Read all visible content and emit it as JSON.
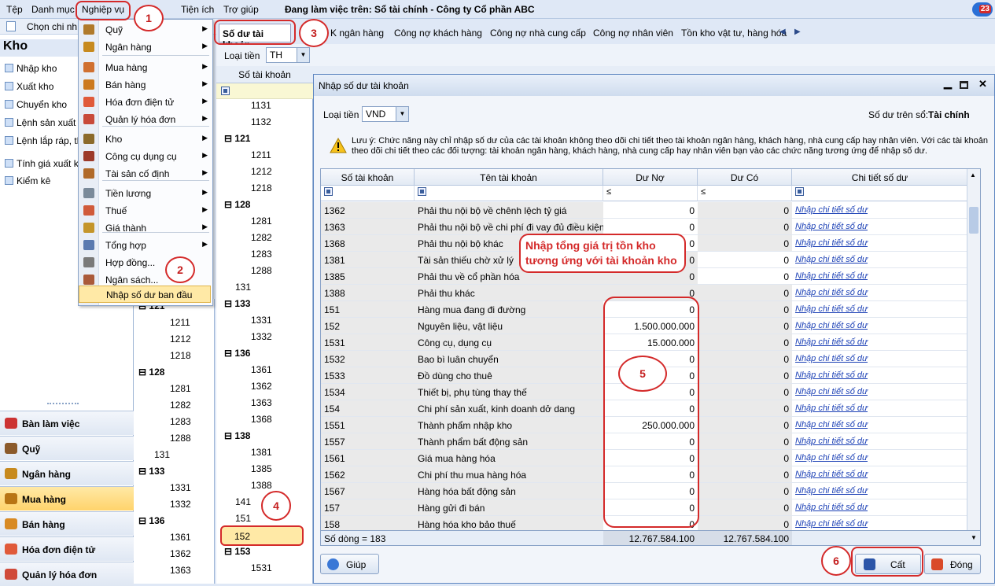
{
  "menubar": {
    "items": [
      "Tệp",
      "Danh mục",
      "Nghiệp vụ",
      "Tiện ích",
      "Trợ giúp"
    ],
    "app_title": "Đang làm việc trên: Sổ tài chính - Công ty Cổ phần ABC",
    "badge": "23"
  },
  "toolbar": {
    "chon_chi_nhanh": "Chọn chi nh"
  },
  "sidebar": {
    "title": "Kho",
    "items": [
      "Nhập kho",
      "Xuất kho",
      "Chuyển kho",
      "Lệnh sản xuất",
      "Lệnh lắp ráp, th",
      "Tính giá xuất kh",
      "Kiểm kê"
    ],
    "nav": [
      "Bàn làm việc",
      "Quỹ",
      "Ngân hàng",
      "Mua hàng",
      "Bán hàng",
      "Hóa đơn điện tử",
      "Quản lý hóa đơn"
    ]
  },
  "menu": {
    "items": [
      "Quỹ",
      "Ngân hàng",
      "Mua hàng",
      "Bán hàng",
      "Hóa đơn điện tử",
      "Quản lý hóa đơn",
      "Kho",
      "Công cụ dụng cụ",
      "Tài sản cố định",
      "Tiền lương",
      "Thuế",
      "Giá thành",
      "Tổng hợp",
      "Hợp đồng...",
      "Ngân sách...",
      "Nhập số dư ban đầu"
    ]
  },
  "tabs": {
    "active": "Số dư tài khoản",
    "others": [
      "K ngân hàng",
      "Công nợ khách hàng",
      "Công nợ nhà cung cấp",
      "Công nợ nhân viên",
      "Tồn kho vật tư, hàng hóa"
    ]
  },
  "filter": {
    "label": "Loại tiền",
    "value": "TH"
  },
  "tree_header": "Số tài khoản",
  "tree2": [
    {
      "t": "1131",
      "g": false
    },
    {
      "t": "1132",
      "g": false
    },
    {
      "t": "121",
      "g": true
    },
    {
      "t": "1211",
      "g": false
    },
    {
      "t": "1212",
      "g": false
    },
    {
      "t": "1218",
      "g": false
    },
    {
      "t": "128",
      "g": true
    },
    {
      "t": "1281",
      "g": false
    },
    {
      "t": "1282",
      "g": false
    },
    {
      "t": "1283",
      "g": false
    },
    {
      "t": "1288",
      "g": false
    },
    {
      "t": "131",
      "g": false
    },
    {
      "t": "133",
      "g": true
    },
    {
      "t": "1331",
      "g": false
    },
    {
      "t": "1332",
      "g": false
    },
    {
      "t": "136",
      "g": true
    },
    {
      "t": "1361",
      "g": false
    },
    {
      "t": "1362",
      "g": false
    },
    {
      "t": "1363",
      "g": false
    },
    {
      "t": "1368",
      "g": false
    },
    {
      "t": "138",
      "g": true
    },
    {
      "t": "1381",
      "g": false
    },
    {
      "t": "1385",
      "g": false
    },
    {
      "t": "1388",
      "g": false
    },
    {
      "t": "141",
      "g": false
    },
    {
      "t": "151",
      "g": false
    },
    {
      "t": "152",
      "g": false
    },
    {
      "t": "153",
      "g": true
    },
    {
      "t": "1531",
      "g": false
    }
  ],
  "tree1": [
    {
      "t": "121",
      "g": true
    },
    {
      "t": "1211",
      "g": false
    },
    {
      "t": "1212",
      "g": false
    },
    {
      "t": "1218",
      "g": false
    },
    {
      "t": "128",
      "g": true
    },
    {
      "t": "1281",
      "g": false
    },
    {
      "t": "1282",
      "g": false
    },
    {
      "t": "1283",
      "g": false
    },
    {
      "t": "1288",
      "g": false
    },
    {
      "t": "131",
      "g": false
    },
    {
      "t": "133",
      "g": true
    },
    {
      "t": "1331",
      "g": false
    },
    {
      "t": "1332",
      "g": false
    },
    {
      "t": "136",
      "g": true
    },
    {
      "t": "1361",
      "g": false
    },
    {
      "t": "1362",
      "g": false
    },
    {
      "t": "1363",
      "g": false
    }
  ],
  "dialog": {
    "title": "Nhập số dư tài khoản",
    "loai_tien_label": "Loại tiền",
    "loai_tien_value": "VND",
    "so_du_tren_so_label": "Số dư trên sổ:",
    "so_du_tren_so_value": "Tài chính",
    "note": "Lưu ý: Chức năng này chỉ nhập số dư của các tài khoản không theo dõi chi tiết theo tài khoản ngân hàng, khách hàng, nhà cung cấp hay nhân viên. Với các tài khoản theo dõi chi tiết theo các đối tượng: tài khoản ngân hàng, khách hàng, nhà cung cấp hay nhân viên bạn vào các chức năng tương ứng để nhập số dư.",
    "columns": [
      "Số tài khoản",
      "Tên tài khoản",
      "Dư Nợ",
      "Dư Có",
      "Chi tiết số dư"
    ],
    "filter_ops": [
      "≤",
      "≤"
    ],
    "rows": [
      {
        "acc": "1362",
        "name": "Phải thu nội bộ về chênh lệch tỷ giá",
        "no": "0",
        "co": "0",
        "ro_no": false,
        "ro_co": true
      },
      {
        "acc": "1363",
        "name": "Phải thu nội bộ về chi phí đi vay đủ điều kiện",
        "no": "0",
        "co": "0",
        "ro_no": false,
        "ro_co": true
      },
      {
        "acc": "1368",
        "name": "Phải thu nội bộ khác",
        "no": "0",
        "co": "0",
        "ro_no": false,
        "ro_co": true
      },
      {
        "acc": "1381",
        "name": "Tài sản thiếu chờ xử lý",
        "no": "0",
        "co": "0",
        "ro_no": true,
        "ro_co": false
      },
      {
        "acc": "1385",
        "name": "Phải thu về cổ phần hóa",
        "no": "0",
        "co": "0",
        "ro_no": true,
        "ro_co": false
      },
      {
        "acc": "1388",
        "name": "Phải thu khác",
        "no": "0",
        "co": "0",
        "ro_no": true,
        "ro_co": true
      },
      {
        "acc": "151",
        "name": "Hàng mua đang đi đường",
        "no": "0",
        "co": "0",
        "ro_no": false,
        "ro_co": true
      },
      {
        "acc": "152",
        "name": "Nguyên liệu, vật liệu",
        "no": "1.500.000.000",
        "co": "0",
        "ro_no": false,
        "ro_co": true
      },
      {
        "acc": "1531",
        "name": "Công cụ, dụng cụ",
        "no": "15.000.000",
        "co": "0",
        "ro_no": false,
        "ro_co": true
      },
      {
        "acc": "1532",
        "name": "Bao bì luân chuyển",
        "no": "0",
        "co": "0",
        "ro_no": false,
        "ro_co": true
      },
      {
        "acc": "1533",
        "name": "Đồ dùng cho thuê",
        "no": "0",
        "co": "0",
        "ro_no": false,
        "ro_co": true
      },
      {
        "acc": "1534",
        "name": "Thiết bị, phụ tùng thay thế",
        "no": "0",
        "co": "0",
        "ro_no": false,
        "ro_co": true
      },
      {
        "acc": "154",
        "name": "Chi phí sản xuất, kinh doanh dở dang",
        "no": "0",
        "co": "0",
        "ro_no": false,
        "ro_co": true
      },
      {
        "acc": "1551",
        "name": "Thành phẩm nhập kho",
        "no": "250.000.000",
        "co": "0",
        "ro_no": false,
        "ro_co": true
      },
      {
        "acc": "1557",
        "name": "Thành phẩm bất động sản",
        "no": "0",
        "co": "0",
        "ro_no": false,
        "ro_co": true
      },
      {
        "acc": "1561",
        "name": "Giá mua hàng hóa",
        "no": "0",
        "co": "0",
        "ro_no": false,
        "ro_co": true
      },
      {
        "acc": "1562",
        "name": "Chi phí thu mua hàng hóa",
        "no": "0",
        "co": "0",
        "ro_no": false,
        "ro_co": true
      },
      {
        "acc": "1567",
        "name": "Hàng hóa bất động sản",
        "no": "0",
        "co": "0",
        "ro_no": false,
        "ro_co": true
      },
      {
        "acc": "157",
        "name": "Hàng gửi đi bán",
        "no": "0",
        "co": "0",
        "ro_no": false,
        "ro_co": true
      },
      {
        "acc": "158",
        "name": "Hàng hóa kho bảo thuế",
        "no": "0",
        "co": "0",
        "ro_no": false,
        "ro_co": true
      }
    ],
    "link_text": "Nhập chi tiết số dư",
    "footer": {
      "count": "Số dòng = 183",
      "total_no": "12.767.584.100",
      "total_co": "12.767.584.100"
    },
    "buttons": {
      "help": "Giúp",
      "save": "Cất",
      "close": "Đóng"
    }
  },
  "annotations": {
    "n1": "1",
    "n2": "2",
    "n3": "3",
    "n4": "4",
    "n5": "5",
    "n6": "6",
    "callout": "Nhập tổng giá trị tồn kho tương ứng với tài khoản kho"
  },
  "colors": {
    "accent": "#d42a2a",
    "link": "#1a3fb5",
    "selected": "#ffd36b"
  }
}
